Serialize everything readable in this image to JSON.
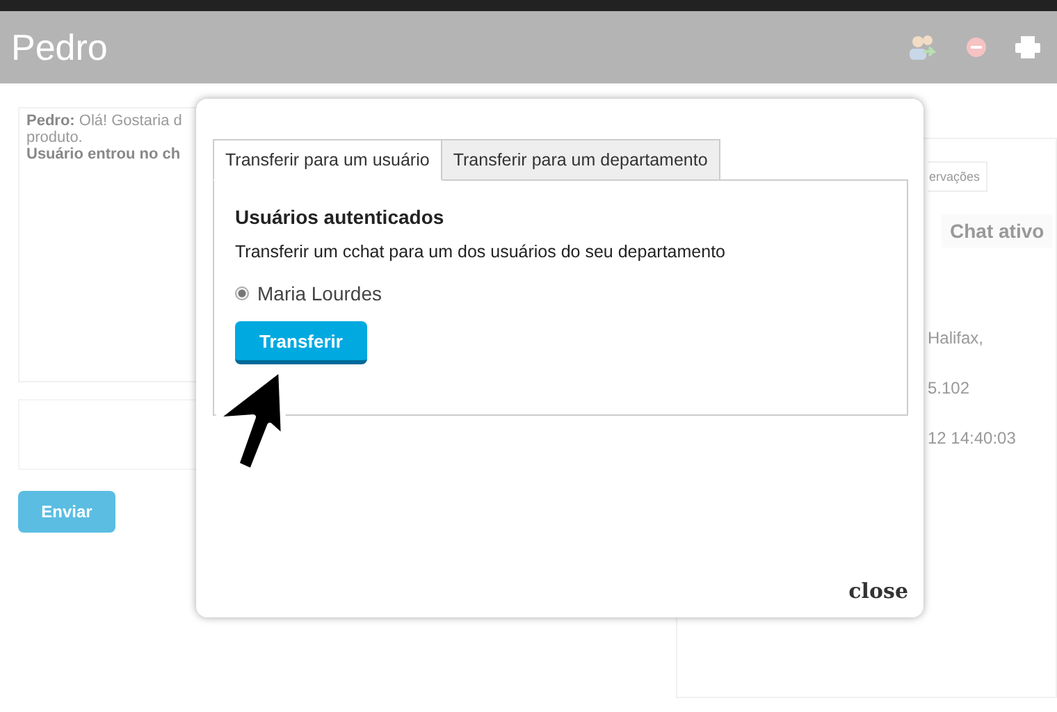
{
  "header": {
    "title": "Pedro"
  },
  "chat": {
    "message": {
      "author": "Pedro:",
      "lines": [
        "Olá! Gostaria d",
        "produto."
      ]
    },
    "system_message": "Usuário entrou no ch",
    "send_button": "Enviar"
  },
  "side_panel": {
    "tab": "ervações",
    "status": "Chat ativo",
    "info_lines": [
      "Halifax,",
      "5.102",
      "12 14:40:03"
    ]
  },
  "modal": {
    "tabs": [
      {
        "label": "Transferir para um usuário",
        "selected": true
      },
      {
        "label": "Transferir para um departamento",
        "selected": false
      }
    ],
    "heading": "Usuários autenticados",
    "description": "Transferir um cchat para um dos usuários do seu departamento",
    "options": [
      {
        "label": "Maria Lourdes",
        "selected": true
      }
    ],
    "button": "Transferir",
    "close": "close"
  }
}
